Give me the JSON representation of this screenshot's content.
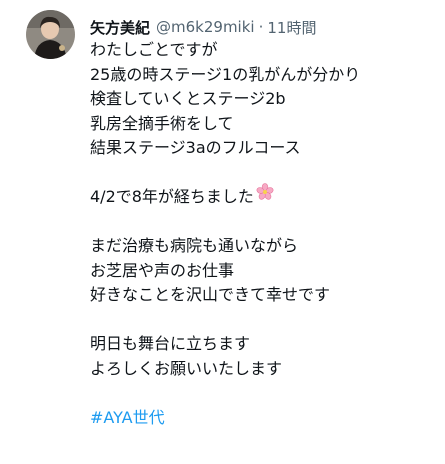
{
  "tweet": {
    "author_name": "矢方美紀",
    "handle": "@m6k29miki",
    "separator": "·",
    "time": "11時間",
    "lines": [
      "わたしごとですが",
      "25歳の時ステージ1の乳がんが分かり",
      "検査していくとステージ2b",
      "乳房全摘手術をして",
      "結果ステージ3aのフルコース",
      "",
      "4/2で8年が経ちました",
      "",
      "まだ治療も病院も通いながら",
      "お芝居や声のお仕事",
      "好きなことを沢山できて幸せです",
      "",
      "明日も舞台に立ちます",
      "よろしくお願いいたします",
      ""
    ],
    "hashtag": "#AYA世代",
    "emoji_icon": "cherry-blossom-icon",
    "hashtag_color": "#1d9bf0",
    "secondary_text_color": "#536471"
  }
}
